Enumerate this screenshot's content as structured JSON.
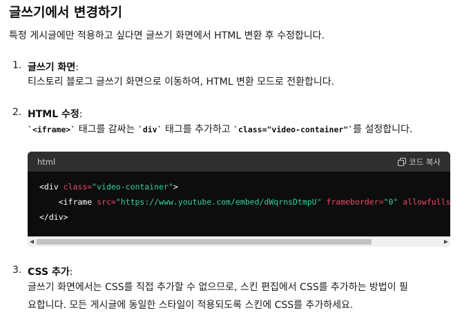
{
  "heading": "글쓰기에서 변경하기",
  "intro": "특정 게시글에만 적용하고 싶다면 글쓰기 화면에서 HTML 변환 후 수정합니다.",
  "steps": [
    {
      "num": "1.",
      "title": "글쓰기 화면",
      "colon": ":",
      "desc": "티스토리 블로그 글쓰기 화면으로 이동하여, HTML 변환 모드로 전환합니다."
    },
    {
      "num": "2.",
      "title": "HTML 수정",
      "colon": ":",
      "desc_parts": {
        "bt1": "`",
        "code1": "<iframe>",
        "bt2": "`",
        "t1": " 태그를 감싸는 ",
        "code2": "`div`",
        "t2": " 태그를 추가하고 ",
        "code3": "`class=\"video-container\"`",
        "t3": "를 설정합니다."
      }
    },
    {
      "num": "3.",
      "title": "CSS 추가",
      "colon": ":",
      "desc_line1": "글쓰기 화면에서는 CSS를 직접 추가할 수 없으므로, 스킨 편집에서 CSS를 추가하는 방법이 필",
      "desc_line2": "요합니다. 모든 게시글에 동일한 스타일이 적용되도록 스킨에 CSS를 추가하세요."
    }
  ],
  "code_block": {
    "language": "html",
    "copy_label": "코드 복사",
    "copy_icon": "copy-icon",
    "lines": {
      "l1_tag_open": "<div ",
      "l1_attr": "class=",
      "l1_str": "\"video-container\"",
      "l1_tag_close": ">",
      "l2_tag_open": "    <iframe ",
      "l2_attr1": "src=",
      "l2_str1": "\"https://www.youtube.com/embed/dWqrnsDtmpU\"",
      "l2_attr2": " frameborder=",
      "l2_str2": "\"0\"",
      "l2_attr3": " allowfullscreen",
      "l3_tag": "</div>"
    },
    "colors": {
      "background": "#0d0d0d",
      "header": "#2f2f2f",
      "attribute": "#e9486b",
      "string": "#34d399"
    }
  }
}
